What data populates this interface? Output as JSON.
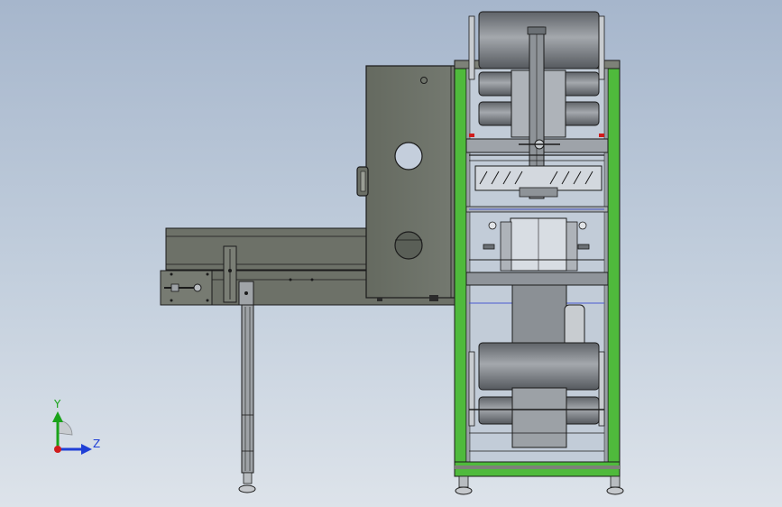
{
  "view": {
    "type": "cad-orthographic-view",
    "background_colors": [
      "#a6b6cc",
      "#dde3ea"
    ]
  },
  "triad": {
    "y_label": "Y",
    "z_label": "Z",
    "y_color": "#1aa31a",
    "z_color": "#1f3fd6",
    "x_color": "#d01c1c"
  },
  "colors": {
    "body_dark": "#6b6f66",
    "frame_green": "#4fba3c",
    "steel": "#8d9196",
    "roller": "#7c8086",
    "outline": "#1b1b1b"
  },
  "components": [
    "conveyor-belt",
    "conveyor-support-leg",
    "control-cabinet-door",
    "main-frame",
    "upper-film-roll",
    "lower-film-roll",
    "sealing-head",
    "guide-rollers"
  ]
}
